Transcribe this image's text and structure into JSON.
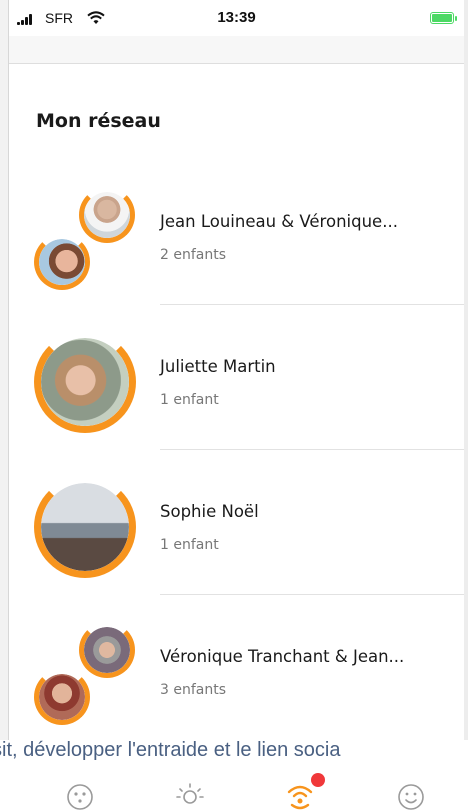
{
  "status_bar": {
    "carrier": "SFR",
    "time": "13:39",
    "battery_color": "#4cd964"
  },
  "page": {
    "title": "Mon réseau"
  },
  "contacts": [
    {
      "name": "Jean  Louineau  & Véronique...",
      "subtitle": "2 enfants",
      "avatar_type": "double"
    },
    {
      "name": "Juliette Martin",
      "subtitle": "1 enfant",
      "avatar_type": "single"
    },
    {
      "name": "Sophie Noël",
      "subtitle": "1 enfant",
      "avatar_type": "single"
    },
    {
      "name": "Véronique  Tranchant & Jean...",
      "subtitle": "3 enfants",
      "avatar_type": "double"
    }
  ],
  "caption": "ysit, développer l'entraide et le lien socia",
  "tab_bar": {
    "tabs": [
      {
        "icon": "dots-circle-icon"
      },
      {
        "icon": "sun-icon"
      },
      {
        "icon": "network-signal-icon",
        "active": true,
        "badge": true
      },
      {
        "icon": "smiley-icon"
      }
    ]
  },
  "colors": {
    "accent_orange": "#f7941d",
    "badge_red": "#f0383a",
    "caption_blue": "#4a6082"
  }
}
